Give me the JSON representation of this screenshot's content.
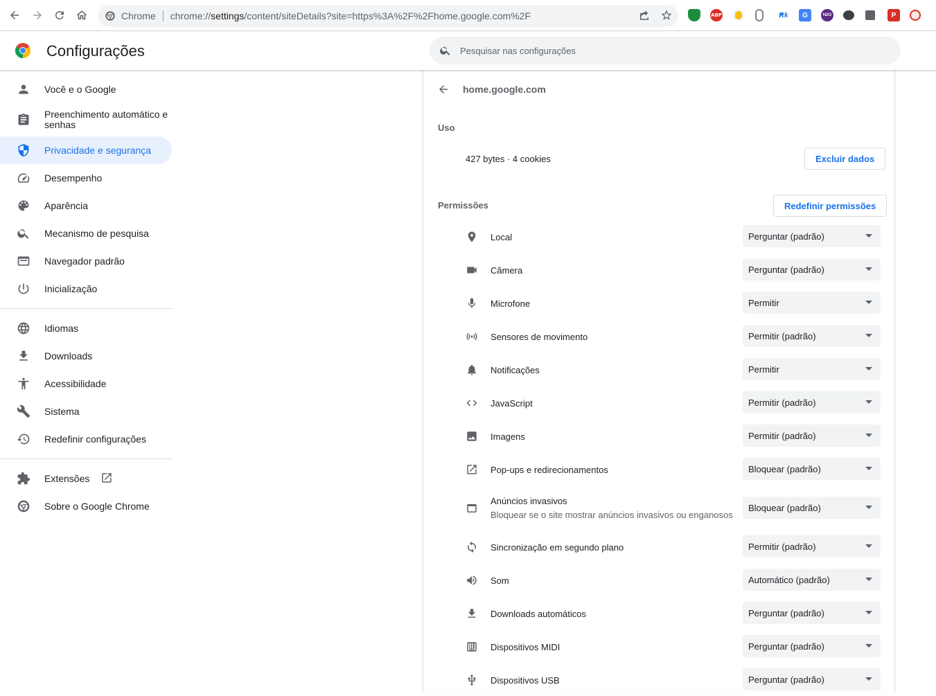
{
  "browser": {
    "omnibox_chip": "Chrome",
    "url_prefix": "chrome://",
    "url_host": "settings",
    "url_path": "/content/siteDetails?site=https%3A%2F%2Fhome.google.com%2F"
  },
  "header": {
    "title": "Configurações",
    "search_placeholder": "Pesquisar nas configurações"
  },
  "sidebar": {
    "items": [
      {
        "label": "Você e o Google",
        "icon": "person-icon"
      },
      {
        "label": "Preenchimento automático e senhas",
        "icon": "clipboard-icon"
      },
      {
        "label": "Privacidade e segurança",
        "icon": "shield-icon",
        "active": true
      },
      {
        "label": "Desempenho",
        "icon": "speedometer-icon"
      },
      {
        "label": "Aparência",
        "icon": "palette-icon"
      },
      {
        "label": "Mecanismo de pesquisa",
        "icon": "search-icon"
      },
      {
        "label": "Navegador padrão",
        "icon": "browser-icon"
      },
      {
        "label": "Inicialização",
        "icon": "power-icon"
      },
      {
        "label": "Idiomas",
        "icon": "globe-icon"
      },
      {
        "label": "Downloads",
        "icon": "download-icon"
      },
      {
        "label": "Acessibilidade",
        "icon": "accessibility-icon"
      },
      {
        "label": "Sistema",
        "icon": "wrench-icon"
      },
      {
        "label": "Redefinir configurações",
        "icon": "history-icon"
      },
      {
        "label": "Extensões",
        "icon": "puzzle-icon"
      },
      {
        "label": "Sobre o Google Chrome",
        "icon": "chrome-icon"
      }
    ]
  },
  "site": {
    "title": "home.google.com",
    "usage_label": "Uso",
    "usage_text": "427 bytes · 4 cookies",
    "clear_button": "Excluir dados",
    "permissions_label": "Permissões",
    "reset_button": "Redefinir permissões"
  },
  "permissions": [
    {
      "label": "Local",
      "value": "Perguntar (padrão)",
      "icon": "location-icon"
    },
    {
      "label": "Câmera",
      "value": "Perguntar (padrão)",
      "icon": "camera-icon"
    },
    {
      "label": "Microfone",
      "value": "Permitir",
      "icon": "microphone-icon"
    },
    {
      "label": "Sensores de movimento",
      "value": "Permitir (padrão)",
      "icon": "sensors-icon"
    },
    {
      "label": "Notificações",
      "value": "Permitir",
      "icon": "bell-icon"
    },
    {
      "label": "JavaScript",
      "value": "Permitir (padrão)",
      "icon": "code-icon"
    },
    {
      "label": "Imagens",
      "value": "Permitir (padrão)",
      "icon": "image-icon"
    },
    {
      "label": "Pop-ups e redirecionamentos",
      "value": "Bloquear (padrão)",
      "icon": "open-external-icon"
    },
    {
      "label": "Anúncios invasivos",
      "sublabel": "Bloquear se o site mostrar anúncios invasivos ou enganosos",
      "value": "Bloquear (padrão)",
      "icon": "window-icon"
    },
    {
      "label": "Sincronização em segundo plano",
      "value": "Permitir (padrão)",
      "icon": "sync-icon"
    },
    {
      "label": "Som",
      "value": "Automático (padrão)",
      "icon": "volume-icon"
    },
    {
      "label": "Downloads automáticos",
      "value": "Perguntar (padrão)",
      "icon": "download-icon"
    },
    {
      "label": "Dispositivos MIDI",
      "value": "Perguntar (padrão)",
      "icon": "piano-icon"
    },
    {
      "label": "Dispositivos USB",
      "value": "Perguntar (padrão)",
      "icon": "usb-icon"
    }
  ],
  "colors": {
    "accent": "#1a73e8",
    "active_bg": "#e8f0fe",
    "select_bg": "#f1f3f4"
  }
}
